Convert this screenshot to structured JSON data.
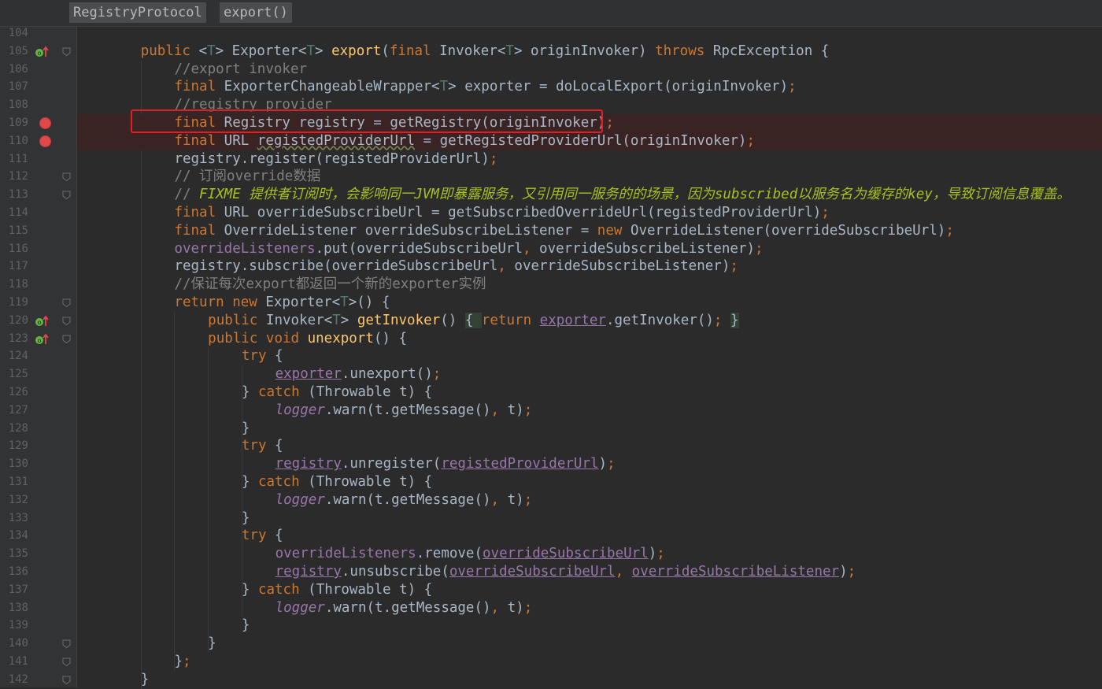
{
  "breadcrumb": {
    "items": [
      "RegistryProtocol",
      "export()"
    ]
  },
  "colors": {
    "keyword": "#cc7832",
    "method": "#ffc66d",
    "comment": "#808080",
    "todo": "#a8c023",
    "field": "#9876aa",
    "type_param": "#507874",
    "text": "#a9b7c6",
    "breakpoint": "#e0484a",
    "highlight_box": "#e51c23"
  },
  "highlight": {
    "target_line": "109",
    "label": "highlight-box"
  },
  "lines": [
    {
      "num": "104",
      "tokens": []
    },
    {
      "num": "105",
      "icon": "override-up-icon",
      "fold": true,
      "indent": 4,
      "tokens": [
        [
          "kw",
          "public "
        ],
        [
          "",
          "<"
        ],
        [
          "tp",
          "T"
        ],
        [
          "",
          "> Exporter<"
        ],
        [
          "tp",
          "T"
        ],
        [
          "",
          "> "
        ],
        [
          "fn",
          "export"
        ],
        [
          "",
          "("
        ],
        [
          "kw",
          "final "
        ],
        [
          "",
          "Invoker<"
        ],
        [
          "tp",
          "T"
        ],
        [
          "",
          "> originInvoker) "
        ],
        [
          "kw",
          "throws "
        ],
        [
          "",
          "RpcException {"
        ]
      ]
    },
    {
      "num": "106",
      "indent": 8,
      "tokens": [
        [
          "cm",
          "//export invoker"
        ]
      ]
    },
    {
      "num": "107",
      "indent": 8,
      "tokens": [
        [
          "kw",
          "final "
        ],
        [
          "",
          "ExporterChangeableWrapper<"
        ],
        [
          "tp",
          "T"
        ],
        [
          "",
          "> exporter = doLocalExport(originInvoker)"
        ],
        [
          "kw",
          ";"
        ]
      ]
    },
    {
      "num": "108",
      "indent": 8,
      "tokens": [
        [
          "cm",
          "//registry provider"
        ]
      ]
    },
    {
      "num": "109",
      "breakpoint": true,
      "indent": 8,
      "tokens": [
        [
          "kw",
          "final "
        ],
        [
          "",
          "Registry registry = getRegistry(originInvoker)"
        ],
        [
          "kw",
          ";"
        ]
      ]
    },
    {
      "num": "110",
      "breakpoint": true,
      "indent": 8,
      "tokens": [
        [
          "kw",
          "final "
        ],
        [
          "",
          "URL "
        ],
        [
          "wv",
          "registedProviderUrl"
        ],
        [
          "",
          " = getRegistedProviderUrl(originInvoker)"
        ],
        [
          "kw",
          ";"
        ]
      ]
    },
    {
      "num": "111",
      "indent": 8,
      "tokens": [
        [
          "",
          "registry.register(registedProviderUrl)"
        ],
        [
          "kw",
          ";"
        ]
      ]
    },
    {
      "num": "112",
      "fold": true,
      "indent": 8,
      "tokens": [
        [
          "cm",
          "// 订阅override数据"
        ]
      ]
    },
    {
      "num": "113",
      "fold": true,
      "indent": 8,
      "tokens": [
        [
          "cm",
          "// "
        ],
        [
          "todo",
          "FIXME 提供者订阅时，会影响同一JVM即暴露服务，又引用同一服务的的场景，因为subscribed以服务名为缓存的key，导致订阅信息覆盖。"
        ]
      ]
    },
    {
      "num": "114",
      "indent": 8,
      "tokens": [
        [
          "kw",
          "final "
        ],
        [
          "",
          "URL overrideSubscribeUrl = getSubscribedOverrideUrl(registedProviderUrl)"
        ],
        [
          "kw",
          ";"
        ]
      ]
    },
    {
      "num": "115",
      "indent": 8,
      "tokens": [
        [
          "kw",
          "final "
        ],
        [
          "",
          "OverrideListener overrideSubscribeListener = "
        ],
        [
          "kw",
          "new "
        ],
        [
          "",
          "OverrideListener(overrideSubscribeUrl)"
        ],
        [
          "kw",
          ";"
        ]
      ]
    },
    {
      "num": "116",
      "indent": 8,
      "tokens": [
        [
          "fld",
          "overrideListeners"
        ],
        [
          "",
          ".put(overrideSubscribeUrl"
        ],
        [
          "kw",
          ", "
        ],
        [
          "",
          "overrideSubscribeListener)"
        ],
        [
          "kw",
          ";"
        ]
      ]
    },
    {
      "num": "117",
      "indent": 8,
      "tokens": [
        [
          "",
          "registry.subscribe(overrideSubscribeUrl"
        ],
        [
          "kw",
          ", "
        ],
        [
          "",
          "overrideSubscribeListener)"
        ],
        [
          "kw",
          ";"
        ]
      ]
    },
    {
      "num": "118",
      "indent": 8,
      "tokens": [
        [
          "cm",
          "//保证每次export都返回一个新的exporter实例"
        ]
      ]
    },
    {
      "num": "119",
      "fold": true,
      "indent": 8,
      "tokens": [
        [
          "kw",
          "return new "
        ],
        [
          "",
          "Exporter<"
        ],
        [
          "tp",
          "T"
        ],
        [
          "",
          ">() {"
        ]
      ]
    },
    {
      "num": "120",
      "icon": "override-up-icon",
      "fold": true,
      "indent": 12,
      "tokens": [
        [
          "kw",
          "public "
        ],
        [
          "",
          "Invoker<"
        ],
        [
          "tp",
          "T"
        ],
        [
          "",
          "> "
        ],
        [
          "fn",
          "getInvoker"
        ],
        [
          "",
          "() "
        ],
        [
          "brace",
          "{ "
        ],
        [
          "kw",
          "return "
        ],
        [
          "ufld",
          "exporter"
        ],
        [
          "",
          ".getInvoker()"
        ],
        [
          "kw",
          "; "
        ],
        [
          "brace",
          "}"
        ]
      ]
    },
    {
      "num": "123",
      "icon": "override-up-icon",
      "fold": true,
      "indent": 12,
      "tokens": [
        [
          "kw",
          "public void "
        ],
        [
          "fn",
          "unexport"
        ],
        [
          "",
          "() {"
        ]
      ]
    },
    {
      "num": "124",
      "indent": 16,
      "tokens": [
        [
          "kw",
          "try "
        ],
        [
          "",
          "{"
        ]
      ]
    },
    {
      "num": "125",
      "indent": 20,
      "tokens": [
        [
          "ufld",
          "exporter"
        ],
        [
          "",
          ".unexport()"
        ],
        [
          "kw",
          ";"
        ]
      ]
    },
    {
      "num": "126",
      "indent": 16,
      "tokens": [
        [
          "",
          "} "
        ],
        [
          "kw",
          "catch "
        ],
        [
          "",
          "(Throwable t) {"
        ]
      ]
    },
    {
      "num": "127",
      "indent": 20,
      "tokens": [
        [
          "lg",
          "logger"
        ],
        [
          "",
          ".warn(t.getMessage()"
        ],
        [
          "kw",
          ", "
        ],
        [
          "",
          "t)"
        ],
        [
          "kw",
          ";"
        ]
      ]
    },
    {
      "num": "128",
      "indent": 16,
      "tokens": [
        [
          "",
          "}"
        ]
      ]
    },
    {
      "num": "129",
      "indent": 16,
      "tokens": [
        [
          "kw",
          "try "
        ],
        [
          "",
          "{"
        ]
      ]
    },
    {
      "num": "130",
      "indent": 20,
      "tokens": [
        [
          "ufld",
          "registry"
        ],
        [
          "",
          ".unregister("
        ],
        [
          "ufld",
          "registedProviderUrl"
        ],
        [
          "",
          ")"
        ],
        [
          "kw",
          ";"
        ]
      ]
    },
    {
      "num": "131",
      "indent": 16,
      "tokens": [
        [
          "",
          "} "
        ],
        [
          "kw",
          "catch "
        ],
        [
          "",
          "(Throwable t) {"
        ]
      ]
    },
    {
      "num": "132",
      "indent": 20,
      "tokens": [
        [
          "lg",
          "logger"
        ],
        [
          "",
          ".warn(t.getMessage()"
        ],
        [
          "kw",
          ", "
        ],
        [
          "",
          "t)"
        ],
        [
          "kw",
          ";"
        ]
      ]
    },
    {
      "num": "133",
      "indent": 16,
      "tokens": [
        [
          "",
          "}"
        ]
      ]
    },
    {
      "num": "134",
      "indent": 16,
      "tokens": [
        [
          "kw",
          "try "
        ],
        [
          "",
          "{"
        ]
      ]
    },
    {
      "num": "135",
      "indent": 20,
      "tokens": [
        [
          "fld",
          "overrideListeners"
        ],
        [
          "",
          ".remove("
        ],
        [
          "ufld",
          "overrideSubscribeUrl"
        ],
        [
          "",
          ")"
        ],
        [
          "kw",
          ";"
        ]
      ]
    },
    {
      "num": "136",
      "indent": 20,
      "tokens": [
        [
          "ufld",
          "registry"
        ],
        [
          "",
          ".unsubscribe("
        ],
        [
          "ufld",
          "overrideSubscribeUrl"
        ],
        [
          "kw",
          ", "
        ],
        [
          "ufld",
          "overrideSubscribeListener"
        ],
        [
          "",
          ")"
        ],
        [
          "kw",
          ";"
        ]
      ]
    },
    {
      "num": "137",
      "indent": 16,
      "tokens": [
        [
          "",
          "} "
        ],
        [
          "kw",
          "catch "
        ],
        [
          "",
          "(Throwable t) {"
        ]
      ]
    },
    {
      "num": "138",
      "indent": 20,
      "tokens": [
        [
          "lg",
          "logger"
        ],
        [
          "",
          ".warn(t.getMessage()"
        ],
        [
          "kw",
          ", "
        ],
        [
          "",
          "t)"
        ],
        [
          "kw",
          ";"
        ]
      ]
    },
    {
      "num": "139",
      "indent": 16,
      "tokens": [
        [
          "",
          "}"
        ]
      ]
    },
    {
      "num": "140",
      "fold": true,
      "indent": 12,
      "tokens": [
        [
          "",
          "}"
        ]
      ]
    },
    {
      "num": "141",
      "fold": true,
      "indent": 8,
      "tokens": [
        [
          "",
          "}"
        ],
        [
          "kw",
          ";"
        ]
      ]
    },
    {
      "num": "142",
      "fold": true,
      "indent": 4,
      "tokens": [
        [
          "",
          "}"
        ]
      ]
    }
  ]
}
